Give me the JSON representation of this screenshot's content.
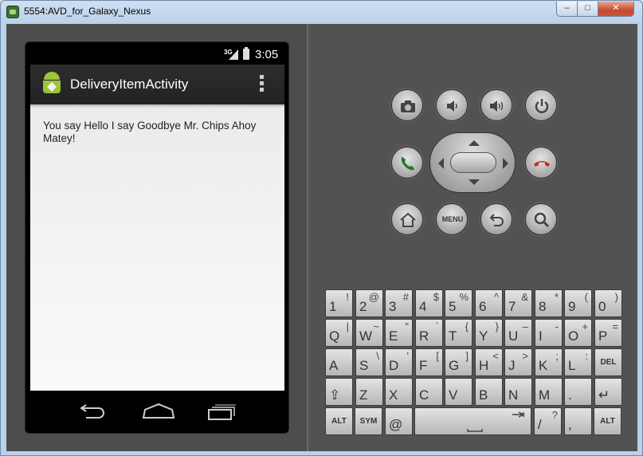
{
  "window": {
    "title": "5554:AVD_for_Galaxy_Nexus",
    "min_glyph": "–",
    "max_glyph": "□",
    "close_glyph": "✕"
  },
  "status_bar": {
    "network": "3G",
    "time": "3:05"
  },
  "action_bar": {
    "title": "DeliveryItemActivity"
  },
  "content": {
    "message": "You say Hello I say Goodbye Mr. Chips Ahoy Matey!"
  },
  "controls": {
    "menu_label": "MENU"
  },
  "keyboard": {
    "rows": [
      [
        [
          "1",
          "!"
        ],
        [
          "2",
          "@"
        ],
        [
          "3",
          "#"
        ],
        [
          "4",
          "$"
        ],
        [
          "5",
          "%"
        ],
        [
          "6",
          "^"
        ],
        [
          "7",
          "&"
        ],
        [
          "8",
          "*"
        ],
        [
          "9",
          "("
        ],
        [
          "0",
          ")"
        ]
      ],
      [
        [
          "Q",
          "|"
        ],
        [
          "W",
          "~"
        ],
        [
          "E",
          "\""
        ],
        [
          "R",
          "`"
        ],
        [
          "T",
          "{"
        ],
        [
          "Y",
          "}"
        ],
        [
          "U",
          "–"
        ],
        [
          "I",
          "-"
        ],
        [
          "O",
          "+"
        ],
        [
          "P",
          "="
        ]
      ],
      [
        [
          "A",
          ""
        ],
        [
          "S",
          "\\"
        ],
        [
          "D",
          "'"
        ],
        [
          "F",
          "["
        ],
        [
          "G",
          "]"
        ],
        [
          "H",
          "<"
        ],
        [
          "J",
          ">"
        ],
        [
          "K",
          ";"
        ],
        [
          "L",
          ":"
        ],
        [
          "DEL",
          ""
        ]
      ],
      [
        [
          "⇪",
          ""
        ],
        [
          "Z",
          ""
        ],
        [
          "X",
          ""
        ],
        [
          "C",
          ""
        ],
        [
          "V",
          ""
        ],
        [
          "B",
          ""
        ],
        [
          "N",
          ""
        ],
        [
          "M",
          ""
        ],
        [
          ".",
          ""
        ],
        [
          "↵",
          ""
        ]
      ]
    ],
    "bottom": {
      "alt_left": "ALT",
      "sym": "SYM",
      "at": "@",
      "slash": "/",
      "question": "?",
      "comma": ",",
      "alt_right": "ALT"
    }
  },
  "colors": {
    "accent_green": "#9bc53d",
    "call_green": "#1a7a2a",
    "end_red": "#c8281e"
  }
}
